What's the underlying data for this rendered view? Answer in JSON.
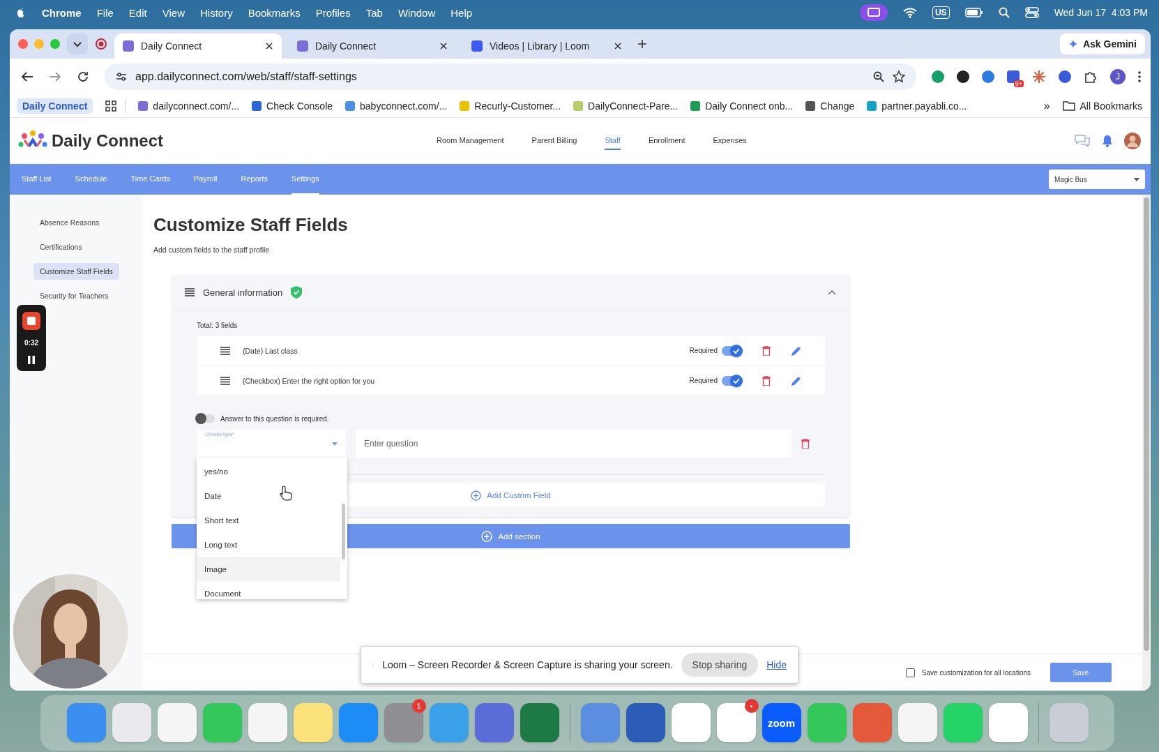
{
  "menu_bar": {
    "app": "Chrome",
    "menus": [
      "File",
      "Edit",
      "View",
      "History",
      "Bookmarks",
      "Profiles",
      "Tab",
      "Window",
      "Help"
    ],
    "input_source": "US",
    "clock": "Wed Jun 17  4:03 PM"
  },
  "browser": {
    "tabs": [
      {
        "title": "Daily Connect",
        "selected": true,
        "color": "#7b6fd6"
      },
      {
        "title": "Daily Connect",
        "selected": false,
        "color": "#7b6fd6"
      },
      {
        "title": "Videos | Library | Loom",
        "selected": false,
        "color": "#3d5bf0"
      }
    ],
    "gemini": "Ask Gemini",
    "url": "app.dailyconnect.com/web/staff/staff-settings",
    "extension_badge": "9+",
    "profile": "J",
    "bookmarks": [
      {
        "label": "Daily Connect",
        "kind": "chip"
      },
      {
        "label": "dailyconnect.com/...",
        "kind": "link",
        "color": "#7b6fd6"
      },
      {
        "label": "Check Console",
        "kind": "link",
        "color": "#2b66d9"
      },
      {
        "label": "babyconnect.com/...",
        "kind": "link",
        "color": "#4a8ee8"
      },
      {
        "label": "Recurly-Customer...",
        "kind": "link",
        "color": "#e8c300"
      },
      {
        "label": "DailyConnect-Pare...",
        "kind": "link",
        "color": "#b7cc6a"
      },
      {
        "label": "Daily Connect onb...",
        "kind": "link",
        "color": "#1f9d55"
      },
      {
        "label": "Change",
        "kind": "link",
        "color": "#555555"
      },
      {
        "label": "partner.payabli.co...",
        "kind": "link",
        "color": "#17a2c8"
      }
    ],
    "more": "»",
    "all_bookmarks": "All Bookmarks"
  },
  "app": {
    "logo": "Daily Connect",
    "top_nav": [
      {
        "label": "Room Management",
        "selected": false
      },
      {
        "label": "Parent Billing",
        "selected": false
      },
      {
        "label": "Staff",
        "selected": true
      },
      {
        "label": "Enrollment",
        "selected": false
      },
      {
        "label": "Expenses",
        "selected": false
      }
    ],
    "sub_nav": [
      {
        "label": "Staff List",
        "selected": false
      },
      {
        "label": "Schedule",
        "selected": false
      },
      {
        "label": "Time Cards",
        "selected": false
      },
      {
        "label": "Payroll",
        "selected": false
      },
      {
        "label": "Reports",
        "selected": false
      },
      {
        "label": "Settings",
        "selected": true
      }
    ],
    "location": "Magic Bus",
    "side_menu": [
      {
        "label": "Absence Reasons",
        "selected": false
      },
      {
        "label": "Certifications",
        "selected": false
      },
      {
        "label": "Customize Staff Fields",
        "selected": true
      },
      {
        "label": "Security for Teachers",
        "selected": false
      }
    ],
    "title": "Customize Staff Fields",
    "subtitle": "Add custom fields to the staff profile",
    "section": {
      "title": "General information",
      "verified": true,
      "expanded": true,
      "total": "Total: 3 fields",
      "fields": [
        {
          "label": "(Date) Last class",
          "required_label": "Required",
          "required": true
        },
        {
          "label": "(Checkbox) Enter the right option for you",
          "required_label": "Required",
          "required": true
        }
      ],
      "new_field": {
        "required": false,
        "required_hint": "Answer to this question is required.",
        "type_label": "Choose type*",
        "question_placeholder": "Enter question"
      },
      "add_field": "Add Custom Field"
    },
    "type_options": [
      {
        "label": "yes/no",
        "highlighted": false
      },
      {
        "label": "Date",
        "highlighted": false
      },
      {
        "label": "Short text",
        "highlighted": false
      },
      {
        "label": "Long text",
        "highlighted": false
      },
      {
        "label": "Image",
        "highlighted": true
      },
      {
        "label": "Document",
        "highlighted": false
      }
    ],
    "add_section": "Add section",
    "save_all": {
      "label": "Save customization for all locations",
      "checked": false
    },
    "save": "Save"
  },
  "recorder": {
    "time": "0:32"
  },
  "share_bar": {
    "message": "Loom – Screen Recorder & Screen Capture is sharing your screen.",
    "stop": "Stop sharing",
    "hide": "Hide"
  },
  "dock": [
    {
      "color": "#3a8ff0"
    },
    {
      "color": "#e9e9ee"
    },
    {
      "color": "#f5f5f5"
    },
    {
      "color": "#34c759"
    },
    {
      "color": "#f5f5f5"
    },
    {
      "color": "#fbe27a"
    },
    {
      "color": "#1e8cf5"
    },
    {
      "color": "#8e8e93",
      "badge": "1"
    },
    {
      "color": "#3aa0e8"
    },
    {
      "color": "#5b6cd8"
    },
    {
      "color": "#1e7a45"
    },
    {
      "color": "#5a8fe0",
      "separator": true
    },
    {
      "color": "#2b5cb8"
    },
    {
      "color": "#ffffff"
    },
    {
      "color": "#ffffff",
      "badge": "•"
    },
    {
      "color": "#0b5cff",
      "text": "zoom"
    },
    {
      "color": "#34c759"
    },
    {
      "color": "#e4583c"
    },
    {
      "color": "#f5f5f5"
    },
    {
      "color": "#25d366"
    },
    {
      "color": "#ffffff"
    },
    {
      "color": "#c9ced6",
      "separator": true
    }
  ]
}
